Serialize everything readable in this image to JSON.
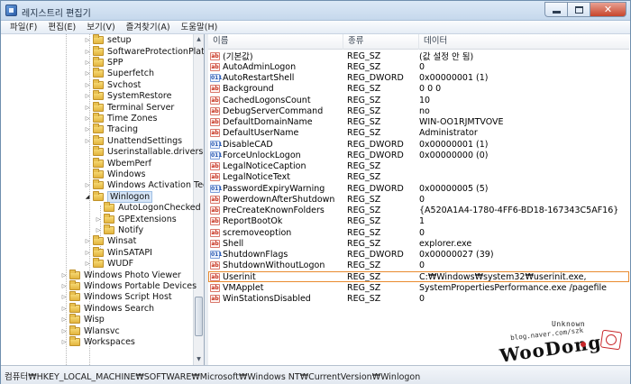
{
  "window": {
    "title": "레지스트리 편집기"
  },
  "menu": [
    "파일(F)",
    "편집(E)",
    "보기(V)",
    "즐겨찾기(A)",
    "도움말(H)"
  ],
  "tree": {
    "items": [
      {
        "label": "setup",
        "expander": "collapsed"
      },
      {
        "label": "SoftwareProtectionPlatfor",
        "expander": "collapsed"
      },
      {
        "label": "SPP",
        "expander": "collapsed"
      },
      {
        "label": "Superfetch",
        "expander": "collapsed"
      },
      {
        "label": "Svchost",
        "expander": "collapsed"
      },
      {
        "label": "SystemRestore",
        "expander": "collapsed"
      },
      {
        "label": "Terminal Server",
        "expander": "collapsed"
      },
      {
        "label": "Time Zones",
        "expander": "collapsed"
      },
      {
        "label": "Tracing",
        "expander": "collapsed"
      },
      {
        "label": "UnattendSettings",
        "expander": "collapsed"
      },
      {
        "label": "Userinstallable.drivers",
        "expander": "none"
      },
      {
        "label": "WbemPerf",
        "expander": "none"
      },
      {
        "label": "Windows",
        "expander": "none"
      },
      {
        "label": "Windows Activation Techn",
        "expander": "collapsed"
      },
      {
        "label": "Winlogon",
        "expander": "expanded"
      },
      {
        "label": "AutoLogonChecked",
        "expander": "none"
      },
      {
        "label": "GPExtensions",
        "expander": "collapsed"
      },
      {
        "label": "Notify",
        "expander": "collapsed"
      },
      {
        "label": "Winsat",
        "expander": "collapsed"
      },
      {
        "label": "WinSATAPI",
        "expander": "collapsed"
      },
      {
        "label": "WUDF",
        "expander": "collapsed"
      },
      {
        "label": "Windows Photo Viewer",
        "expander": "collapsed"
      },
      {
        "label": "Windows Portable Devices",
        "expander": "collapsed"
      },
      {
        "label": "Windows Script Host",
        "expander": "collapsed"
      },
      {
        "label": "Windows Search",
        "expander": "collapsed"
      },
      {
        "label": "Wisp",
        "expander": "collapsed"
      },
      {
        "label": "Wlansvc",
        "expander": "collapsed"
      },
      {
        "label": "Workspaces",
        "expander": "collapsed"
      }
    ]
  },
  "list": {
    "columns": [
      "이름",
      "종류",
      "데이터"
    ],
    "rows": [
      {
        "icon": "sz",
        "name": "(기본값)",
        "type": "REG_SZ",
        "data": "(값 설정 안 됨)"
      },
      {
        "icon": "sz",
        "name": "AutoAdminLogon",
        "type": "REG_SZ",
        "data": "0"
      },
      {
        "icon": "dword",
        "name": "AutoRestartShell",
        "type": "REG_DWORD",
        "data": "0x00000001 (1)"
      },
      {
        "icon": "sz",
        "name": "Background",
        "type": "REG_SZ",
        "data": "0 0 0"
      },
      {
        "icon": "sz",
        "name": "CachedLogonsCount",
        "type": "REG_SZ",
        "data": "10"
      },
      {
        "icon": "sz",
        "name": "DebugServerCommand",
        "type": "REG_SZ",
        "data": "no"
      },
      {
        "icon": "sz",
        "name": "DefaultDomainName",
        "type": "REG_SZ",
        "data": "WIN-OO1RJMTVOVE"
      },
      {
        "icon": "sz",
        "name": "DefaultUserName",
        "type": "REG_SZ",
        "data": "Administrator"
      },
      {
        "icon": "dword",
        "name": "DisableCAD",
        "type": "REG_DWORD",
        "data": "0x00000001 (1)"
      },
      {
        "icon": "dword",
        "name": "ForceUnlockLogon",
        "type": "REG_DWORD",
        "data": "0x00000000 (0)"
      },
      {
        "icon": "sz",
        "name": "LegalNoticeCaption",
        "type": "REG_SZ",
        "data": ""
      },
      {
        "icon": "sz",
        "name": "LegalNoticeText",
        "type": "REG_SZ",
        "data": ""
      },
      {
        "icon": "dword",
        "name": "PasswordExpiryWarning",
        "type": "REG_DWORD",
        "data": "0x00000005 (5)"
      },
      {
        "icon": "sz",
        "name": "PowerdownAfterShutdown",
        "type": "REG_SZ",
        "data": "0"
      },
      {
        "icon": "sz",
        "name": "PreCreateKnownFolders",
        "type": "REG_SZ",
        "data": "{A520A1A4-1780-4FF6-BD18-167343C5AF16}"
      },
      {
        "icon": "sz",
        "name": "ReportBootOk",
        "type": "REG_SZ",
        "data": "1"
      },
      {
        "icon": "sz",
        "name": "scremoveoption",
        "type": "REG_SZ",
        "data": "0"
      },
      {
        "icon": "sz",
        "name": "Shell",
        "type": "REG_SZ",
        "data": "explorer.exe"
      },
      {
        "icon": "dword",
        "name": "ShutdownFlags",
        "type": "REG_DWORD",
        "data": "0x00000027 (39)"
      },
      {
        "icon": "sz",
        "name": "ShutdownWithoutLogon",
        "type": "REG_SZ",
        "data": "0"
      },
      {
        "icon": "sz",
        "name": "Userinit",
        "type": "REG_SZ",
        "data": "C:₩Windows₩system32₩userinit.exe,",
        "highlight": true
      },
      {
        "icon": "sz",
        "name": "VMApplet",
        "type": "REG_SZ",
        "data": "SystemPropertiesPerformance.exe /pagefile"
      },
      {
        "icon": "sz",
        "name": "WinStationsDisabled",
        "type": "REG_SZ",
        "data": "0"
      }
    ]
  },
  "statusbar": {
    "path": "컴퓨터₩HKEY_LOCAL_MACHINE₩SOFTWARE₩Microsoft₩Windows NT₩CurrentVersion₩Winlogon"
  },
  "watermark": {
    "tag": "Unknown",
    "blog": "blog.naver.com/szk",
    "logo": "WooDong"
  },
  "colors": {
    "highlight_outline": "#e98b2f",
    "sz_icon": "#c5301d",
    "dword_icon": "#2757b0"
  }
}
